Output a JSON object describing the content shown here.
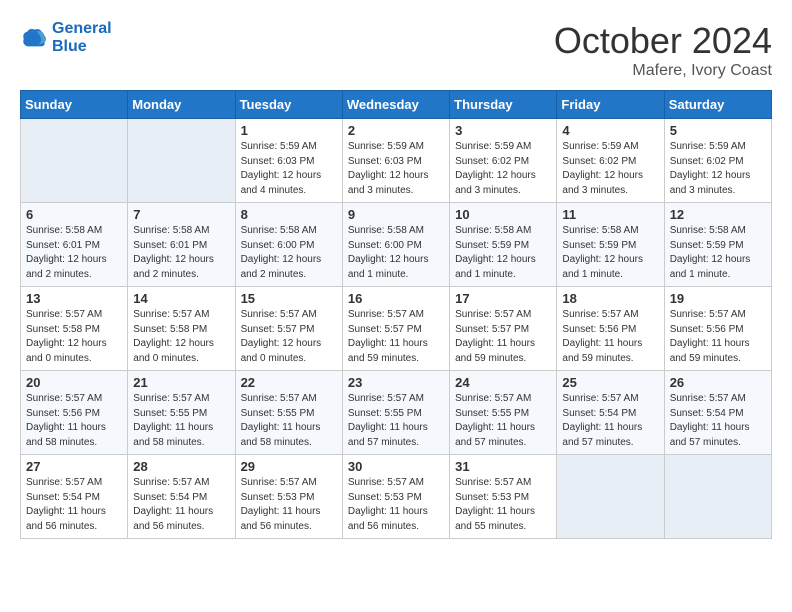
{
  "logo": {
    "line1": "General",
    "line2": "Blue"
  },
  "title": "October 2024",
  "location": "Mafere, Ivory Coast",
  "headers": [
    "Sunday",
    "Monday",
    "Tuesday",
    "Wednesday",
    "Thursday",
    "Friday",
    "Saturday"
  ],
  "weeks": [
    [
      {
        "day": "",
        "info": ""
      },
      {
        "day": "",
        "info": ""
      },
      {
        "day": "1",
        "info": "Sunrise: 5:59 AM\nSunset: 6:03 PM\nDaylight: 12 hours\nand 4 minutes."
      },
      {
        "day": "2",
        "info": "Sunrise: 5:59 AM\nSunset: 6:03 PM\nDaylight: 12 hours\nand 3 minutes."
      },
      {
        "day": "3",
        "info": "Sunrise: 5:59 AM\nSunset: 6:02 PM\nDaylight: 12 hours\nand 3 minutes."
      },
      {
        "day": "4",
        "info": "Sunrise: 5:59 AM\nSunset: 6:02 PM\nDaylight: 12 hours\nand 3 minutes."
      },
      {
        "day": "5",
        "info": "Sunrise: 5:59 AM\nSunset: 6:02 PM\nDaylight: 12 hours\nand 3 minutes."
      }
    ],
    [
      {
        "day": "6",
        "info": "Sunrise: 5:58 AM\nSunset: 6:01 PM\nDaylight: 12 hours\nand 2 minutes."
      },
      {
        "day": "7",
        "info": "Sunrise: 5:58 AM\nSunset: 6:01 PM\nDaylight: 12 hours\nand 2 minutes."
      },
      {
        "day": "8",
        "info": "Sunrise: 5:58 AM\nSunset: 6:00 PM\nDaylight: 12 hours\nand 2 minutes."
      },
      {
        "day": "9",
        "info": "Sunrise: 5:58 AM\nSunset: 6:00 PM\nDaylight: 12 hours\nand 1 minute."
      },
      {
        "day": "10",
        "info": "Sunrise: 5:58 AM\nSunset: 5:59 PM\nDaylight: 12 hours\nand 1 minute."
      },
      {
        "day": "11",
        "info": "Sunrise: 5:58 AM\nSunset: 5:59 PM\nDaylight: 12 hours\nand 1 minute."
      },
      {
        "day": "12",
        "info": "Sunrise: 5:58 AM\nSunset: 5:59 PM\nDaylight: 12 hours\nand 1 minute."
      }
    ],
    [
      {
        "day": "13",
        "info": "Sunrise: 5:57 AM\nSunset: 5:58 PM\nDaylight: 12 hours\nand 0 minutes."
      },
      {
        "day": "14",
        "info": "Sunrise: 5:57 AM\nSunset: 5:58 PM\nDaylight: 12 hours\nand 0 minutes."
      },
      {
        "day": "15",
        "info": "Sunrise: 5:57 AM\nSunset: 5:57 PM\nDaylight: 12 hours\nand 0 minutes."
      },
      {
        "day": "16",
        "info": "Sunrise: 5:57 AM\nSunset: 5:57 PM\nDaylight: 11 hours\nand 59 minutes."
      },
      {
        "day": "17",
        "info": "Sunrise: 5:57 AM\nSunset: 5:57 PM\nDaylight: 11 hours\nand 59 minutes."
      },
      {
        "day": "18",
        "info": "Sunrise: 5:57 AM\nSunset: 5:56 PM\nDaylight: 11 hours\nand 59 minutes."
      },
      {
        "day": "19",
        "info": "Sunrise: 5:57 AM\nSunset: 5:56 PM\nDaylight: 11 hours\nand 59 minutes."
      }
    ],
    [
      {
        "day": "20",
        "info": "Sunrise: 5:57 AM\nSunset: 5:56 PM\nDaylight: 11 hours\nand 58 minutes."
      },
      {
        "day": "21",
        "info": "Sunrise: 5:57 AM\nSunset: 5:55 PM\nDaylight: 11 hours\nand 58 minutes."
      },
      {
        "day": "22",
        "info": "Sunrise: 5:57 AM\nSunset: 5:55 PM\nDaylight: 11 hours\nand 58 minutes."
      },
      {
        "day": "23",
        "info": "Sunrise: 5:57 AM\nSunset: 5:55 PM\nDaylight: 11 hours\nand 57 minutes."
      },
      {
        "day": "24",
        "info": "Sunrise: 5:57 AM\nSunset: 5:55 PM\nDaylight: 11 hours\nand 57 minutes."
      },
      {
        "day": "25",
        "info": "Sunrise: 5:57 AM\nSunset: 5:54 PM\nDaylight: 11 hours\nand 57 minutes."
      },
      {
        "day": "26",
        "info": "Sunrise: 5:57 AM\nSunset: 5:54 PM\nDaylight: 11 hours\nand 57 minutes."
      }
    ],
    [
      {
        "day": "27",
        "info": "Sunrise: 5:57 AM\nSunset: 5:54 PM\nDaylight: 11 hours\nand 56 minutes."
      },
      {
        "day": "28",
        "info": "Sunrise: 5:57 AM\nSunset: 5:54 PM\nDaylight: 11 hours\nand 56 minutes."
      },
      {
        "day": "29",
        "info": "Sunrise: 5:57 AM\nSunset: 5:53 PM\nDaylight: 11 hours\nand 56 minutes."
      },
      {
        "day": "30",
        "info": "Sunrise: 5:57 AM\nSunset: 5:53 PM\nDaylight: 11 hours\nand 56 minutes."
      },
      {
        "day": "31",
        "info": "Sunrise: 5:57 AM\nSunset: 5:53 PM\nDaylight: 11 hours\nand 55 minutes."
      },
      {
        "day": "",
        "info": ""
      },
      {
        "day": "",
        "info": ""
      }
    ]
  ]
}
